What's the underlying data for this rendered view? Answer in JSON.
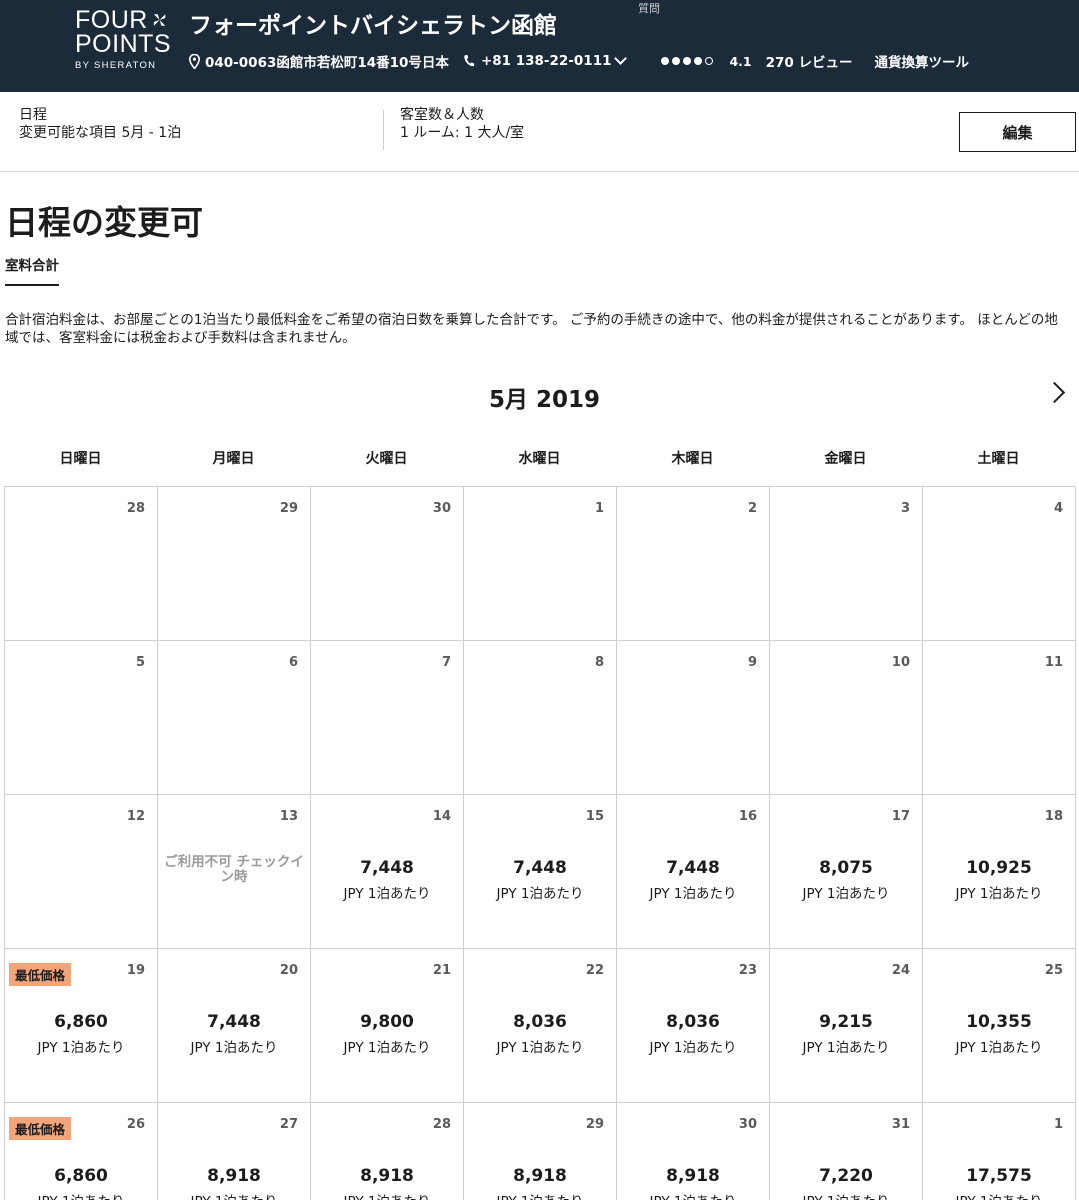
{
  "header": {
    "logo_line1": "FOUR",
    "logo_line2": "POINTS",
    "logo_line3": "BY SHERATON",
    "hotel_name": "フォーポイントバイシェラトン函館",
    "top_small_text": "質問",
    "address": "040-0063函館市若松町14番10号日本",
    "phone": "+81 138-22-0111",
    "rating_dots_filled": 4,
    "rating_dots_total": 5,
    "rating": "4.1",
    "reviews": "270 レビュー",
    "currency_tool": "通貨換算ツール"
  },
  "summary": {
    "dates_label": "日程",
    "dates_value": "変更可能な項目 5月 - 1泊",
    "rooms_label": "客室数＆人数",
    "rooms_value": "1 ルーム: 1 大人/室",
    "edit_label": "編集"
  },
  "page": {
    "title": "日程の変更可",
    "tab_label": "室料合計",
    "description": "合計宿泊料金は、お部屋ごとの1泊当たり最低料金をご希望の宿泊日数を乗算した合計です。 ご予約の手続きの途中で、他の料金が提供されることがあります。 ほとんどの地域では、客室料金には税金および手数料は含まれません。"
  },
  "calendar": {
    "month_label": "5月 2019",
    "weekdays": [
      "日曜日",
      "月曜日",
      "火曜日",
      "水曜日",
      "木曜日",
      "金曜日",
      "土曜日"
    ],
    "lowest_badge": "最低価格",
    "per_night": "JPY 1泊あたり",
    "unavailable": "ご利用不可 チェックイン時",
    "cells": [
      {
        "day": "28"
      },
      {
        "day": "29"
      },
      {
        "day": "30"
      },
      {
        "day": "1"
      },
      {
        "day": "2"
      },
      {
        "day": "3"
      },
      {
        "day": "4"
      },
      {
        "day": "5"
      },
      {
        "day": "6"
      },
      {
        "day": "7"
      },
      {
        "day": "8"
      },
      {
        "day": "9"
      },
      {
        "day": "10"
      },
      {
        "day": "11"
      },
      {
        "day": "12"
      },
      {
        "day": "13",
        "status": "unavailable"
      },
      {
        "day": "14",
        "price": "7,448"
      },
      {
        "day": "15",
        "price": "7,448"
      },
      {
        "day": "16",
        "price": "7,448"
      },
      {
        "day": "17",
        "price": "8,075"
      },
      {
        "day": "18",
        "price": "10,925"
      },
      {
        "day": "19",
        "price": "6,860",
        "lowest": true
      },
      {
        "day": "20",
        "price": "7,448"
      },
      {
        "day": "21",
        "price": "9,800"
      },
      {
        "day": "22",
        "price": "8,036"
      },
      {
        "day": "23",
        "price": "8,036"
      },
      {
        "day": "24",
        "price": "9,215"
      },
      {
        "day": "25",
        "price": "10,355"
      },
      {
        "day": "26",
        "price": "6,860",
        "lowest": true
      },
      {
        "day": "27",
        "price": "8,918"
      },
      {
        "day": "28",
        "price": "8,918"
      },
      {
        "day": "29",
        "price": "8,918"
      },
      {
        "day": "30",
        "price": "8,918"
      },
      {
        "day": "31",
        "price": "7,220"
      },
      {
        "day": "1",
        "price": "17,575"
      }
    ]
  }
}
